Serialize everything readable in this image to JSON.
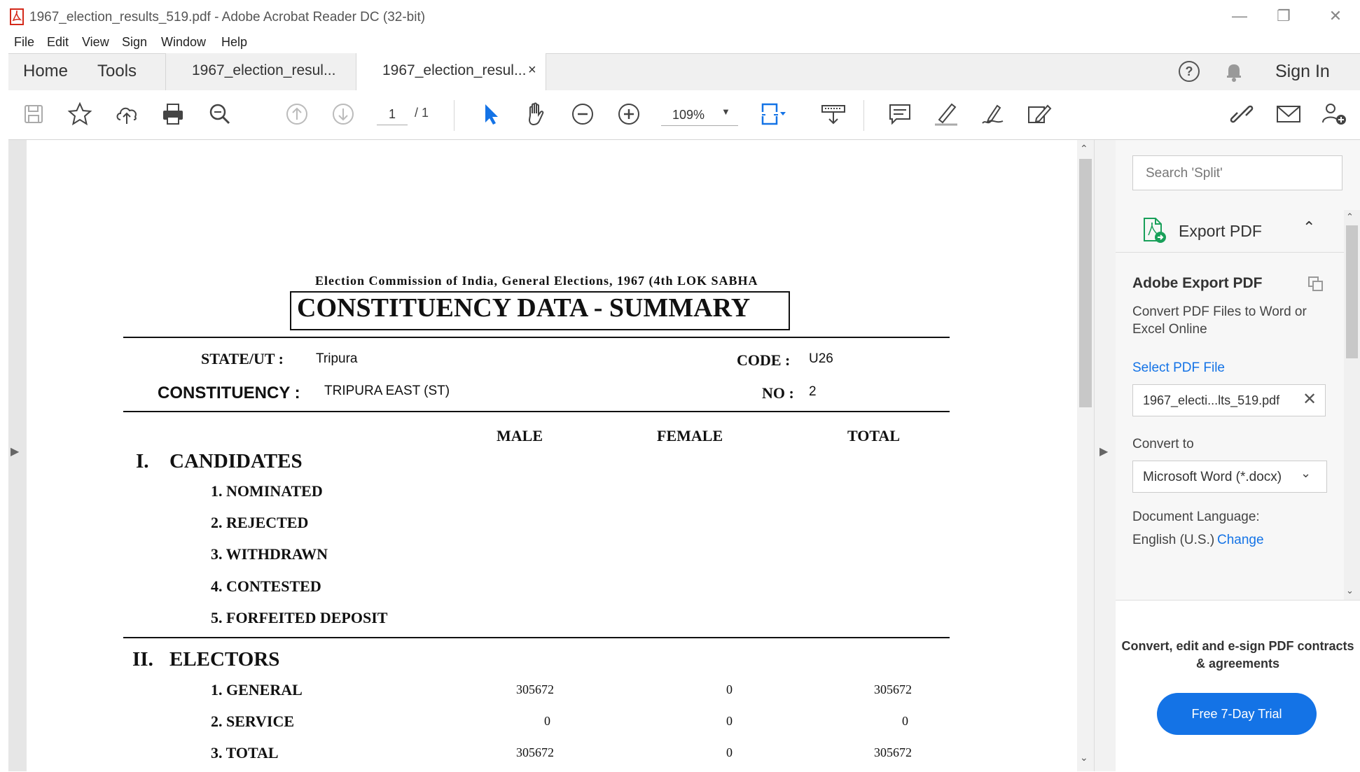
{
  "window": {
    "title": "1967_election_results_519.pdf - Adobe Acrobat Reader DC (32-bit)",
    "minimize": "—",
    "restore": "❐",
    "close": "✕"
  },
  "menu": [
    "File",
    "Edit",
    "View",
    "Sign",
    "Window",
    "Help"
  ],
  "tabs": {
    "home": "Home",
    "tools": "Tools",
    "doc_tab_1": "1967_election_resul...",
    "doc_tab_2": "1967_election_resul...",
    "close": "×",
    "sign_in": "Sign In"
  },
  "toolbar": {
    "page_current": "1",
    "page_total": "/ 1",
    "zoom": "109%",
    "zoom_arrow": "▼"
  },
  "document": {
    "header": "Election Commission of India, General Elections, 1967 (4th LOK SABHA",
    "title": "CONSTITUENCY DATA - SUMMARY",
    "state_label": "STATE/UT :",
    "state_value": "Tripura",
    "code_label": "CODE :",
    "code_value": "U26",
    "constituency_label": "CONSTITUENCY :",
    "constituency_value": "TRIPURA EAST (ST)",
    "no_label": "NO :",
    "no_value": "2",
    "col_male": "MALE",
    "col_female": "FEMALE",
    "col_total": "TOTAL",
    "section1_num": "I.",
    "section1_title": "CANDIDATES",
    "candidates": [
      "1. NOMINATED",
      "2. REJECTED",
      "3. WITHDRAWN",
      "4. CONTESTED",
      "5. FORFEITED DEPOSIT"
    ],
    "section2_num": "II.",
    "section2_title": "ELECTORS",
    "electors": [
      {
        "label": "1. GENERAL",
        "male": "305672",
        "female": "0",
        "total": "305672"
      },
      {
        "label": "2. SERVICE",
        "male": "0",
        "female": "0",
        "total": "0"
      },
      {
        "label": "3. TOTAL",
        "male": "305672",
        "female": "0",
        "total": "305672"
      }
    ]
  },
  "right_pane": {
    "search_placeholder": "Search 'Split'",
    "export_title": "Export PDF",
    "export_chevron": "⌃",
    "ae_title": "Adobe Export PDF",
    "ae_desc": "Convert PDF Files to Word or Excel Online",
    "select_file": "Select PDF File",
    "file_name": "1967_electi...lts_519.pdf",
    "file_remove": "✕",
    "convert_label": "Convert to",
    "convert_value": "Microsoft Word (*.docx)",
    "convert_chevron": "⌄",
    "lang_label": "Document Language:",
    "lang_value": "English (U.S.)",
    "lang_change": "Change",
    "promo": "Convert, edit and e-sign PDF contracts & agreements",
    "trial_button": "Free 7-Day Trial"
  },
  "glyphs": {
    "left_arrow": "▶",
    "right_arrow": "▶",
    "scroll_up": "⌃",
    "scroll_down": "⌄"
  },
  "colors": {
    "accent": "#1473e6",
    "tab_bar": "#f0f0f0",
    "doc_bg": "#e6e6e6"
  }
}
